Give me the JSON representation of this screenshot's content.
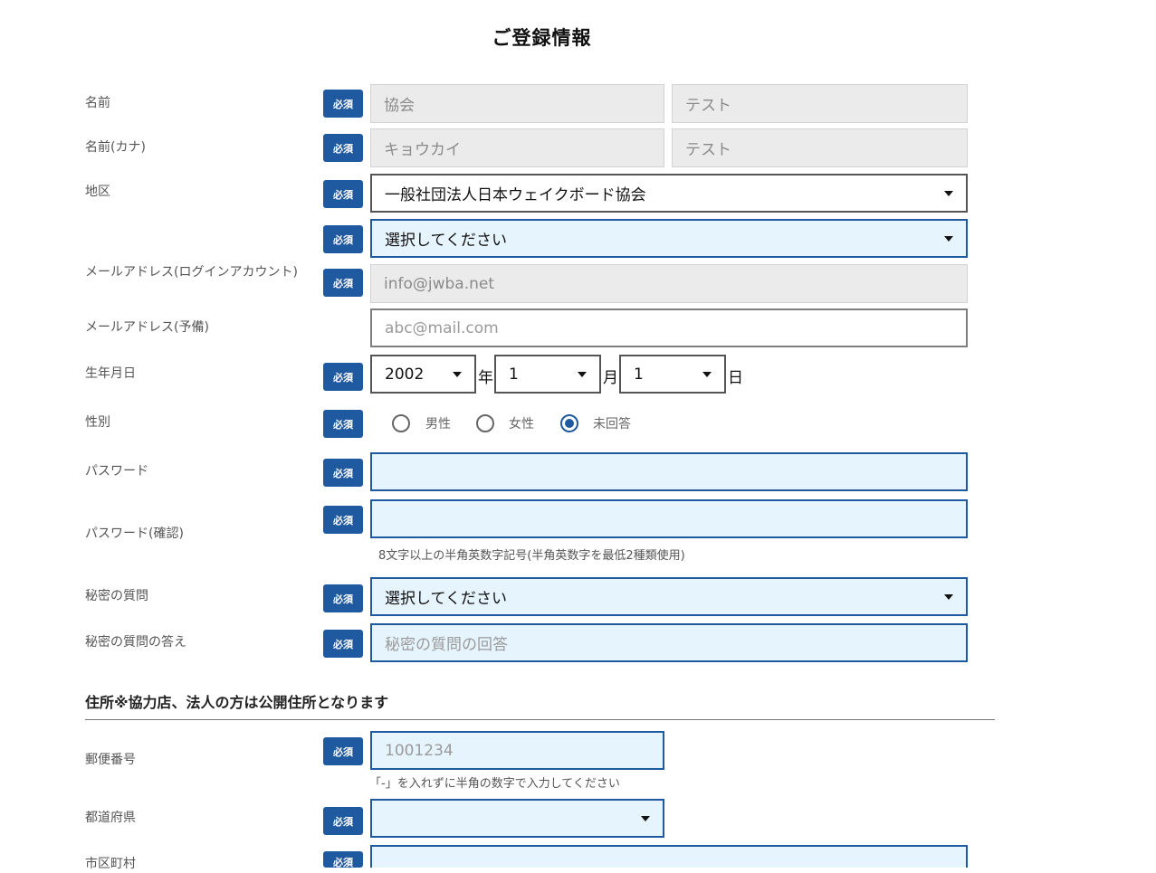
{
  "title": "ご登録情報",
  "required_label": "必須",
  "fields": {
    "name": {
      "label": "名前",
      "last": "協会",
      "first": "テスト"
    },
    "kana": {
      "label": "名前(カナ)",
      "last": "キョウカイ",
      "first": "テスト"
    },
    "region": {
      "label": "地区",
      "value": "一般社団法人日本ウェイクボード協会",
      "sub_value": "選択してください"
    },
    "email": {
      "label": "メールアドレス(ログインアカウント)",
      "value": "info@jwba.net"
    },
    "email_sub": {
      "label": "メールアドレス(予備)",
      "placeholder": "abc@mail.com"
    },
    "birthday": {
      "label": "生年月日",
      "year": "2002",
      "year_unit": "年",
      "month": "1",
      "month_unit": "月",
      "day": "1",
      "day_unit": "日"
    },
    "gender": {
      "label": "性別",
      "options": [
        "男性",
        "女性",
        "未回答"
      ],
      "selected": "未回答"
    },
    "password": {
      "label": "パスワード",
      "value": ""
    },
    "password_confirm": {
      "label": "パスワード(確認)",
      "value": "",
      "hint": "8文字以上の半角英数字記号(半角英数字を最低2種類使用)"
    },
    "secret_question": {
      "label": "秘密の質問",
      "value": "選択してください"
    },
    "secret_answer": {
      "label": "秘密の質問の答え",
      "placeholder": "秘密の質問の回答"
    }
  },
  "address_section": {
    "heading": "住所※協力店、法人の方は公開住所となります",
    "postal": {
      "label": "郵便番号",
      "placeholder": "1001234",
      "hint": "「-」を入れずに半角の数字で入力してください"
    },
    "prefecture": {
      "label": "都道府県",
      "value": ""
    },
    "city": {
      "label": "市区町村",
      "value": ""
    }
  },
  "colors": {
    "accent": "#1f5aa0",
    "field_bg": "#e6f4fd",
    "readonly_bg": "#ebebeb"
  }
}
